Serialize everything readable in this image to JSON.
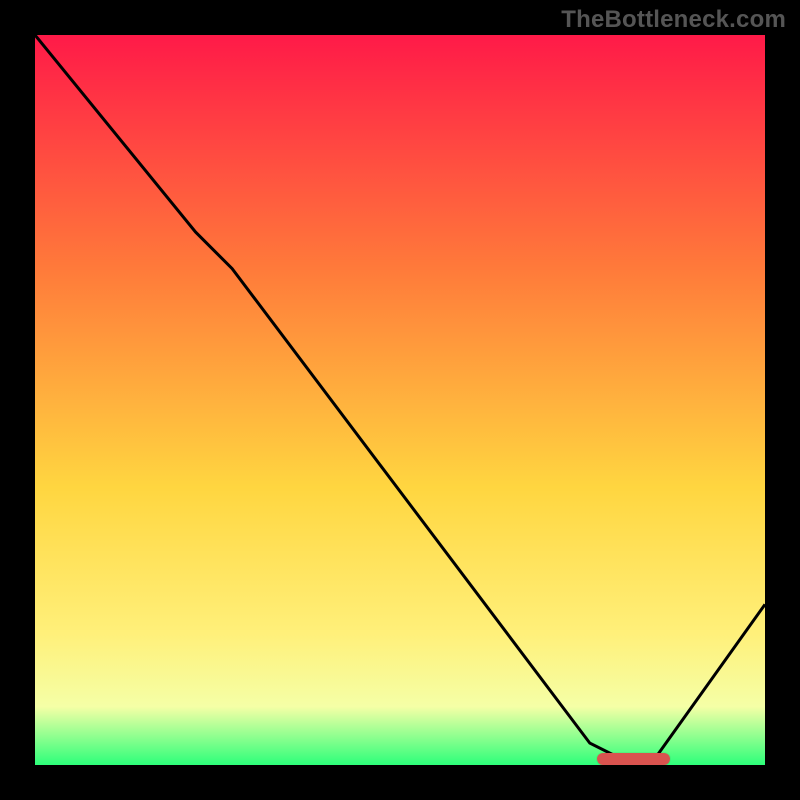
{
  "watermark": "TheBottleneck.com",
  "colors": {
    "top": "#ff1a48",
    "mid1": "#ff7a3a",
    "mid2": "#ffd640",
    "mid3": "#fff07a",
    "mid4": "#f5ffa6",
    "bottom": "#2dff7a",
    "line": "#000000",
    "marker": "#d9534f"
  },
  "chart_data": {
    "type": "line",
    "title": "",
    "xlabel": "",
    "ylabel": "",
    "xlim": [
      0,
      100
    ],
    "ylim": [
      0,
      100
    ],
    "grid": false,
    "legend": false,
    "x": [
      0,
      22,
      27,
      76,
      80,
      85,
      100
    ],
    "values": [
      100,
      73,
      68,
      3,
      1,
      1,
      22
    ],
    "description": "Single black curve on a vertical red→orange→yellow→green gradient. Curve starts at the top-left corner, drops steeply then bends slightly, descends roughly linearly to a flat minimum near x≈80–85 at the very bottom of the plot, then rises toward the right edge. A short horizontal red rounded marker sits on the flat minimum segment."
  },
  "marker": {
    "x_start": 77,
    "x_end": 87,
    "y": 0.8
  }
}
